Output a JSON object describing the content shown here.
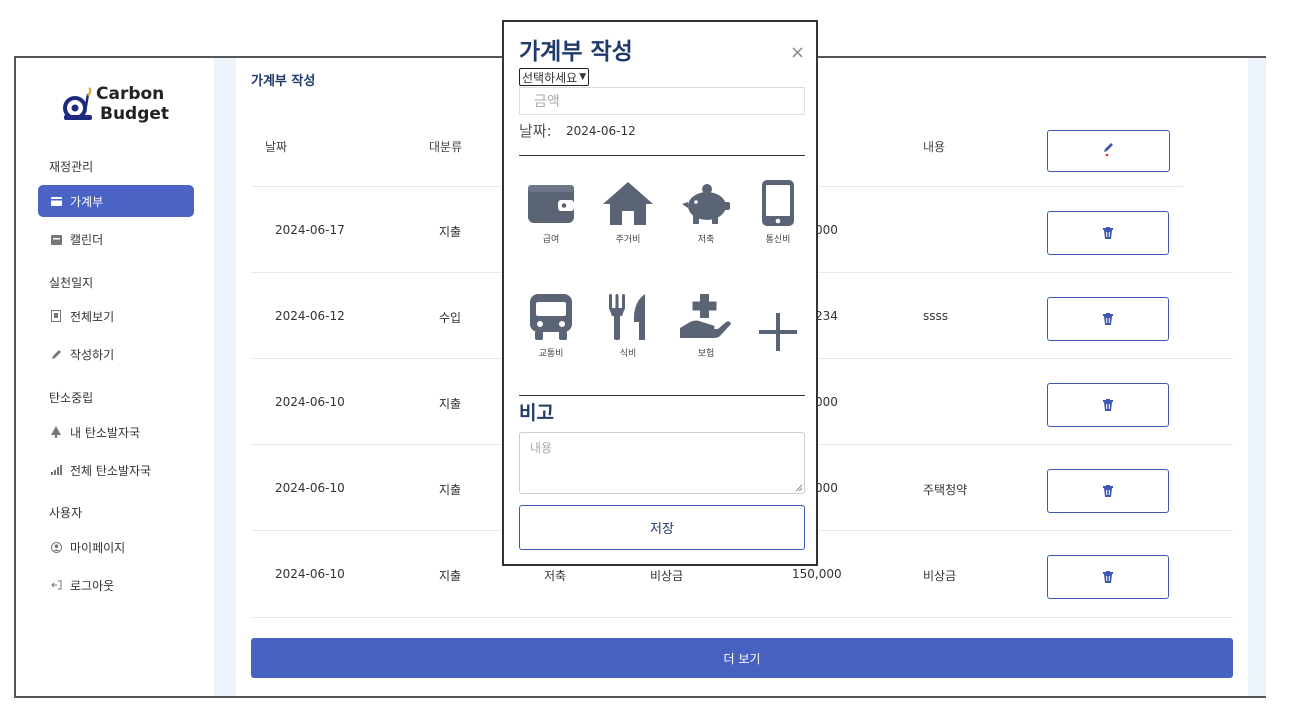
{
  "logo": {
    "line1": "Carbon",
    "line2": "Budget"
  },
  "sidebar": {
    "sections": [
      {
        "title": "재정관리",
        "items": [
          {
            "label": "가계부",
            "icon": "wallet-icon",
            "active": true
          },
          {
            "label": "캘린더",
            "icon": "calendar-icon",
            "active": false
          }
        ]
      },
      {
        "title": "실천일지",
        "items": [
          {
            "label": "전체보기",
            "icon": "list-icon",
            "active": false
          },
          {
            "label": "작성하기",
            "icon": "pencil-icon",
            "active": false
          }
        ]
      },
      {
        "title": "탄소중립",
        "items": [
          {
            "label": "내 탄소발자국",
            "icon": "tree-icon",
            "active": false
          },
          {
            "label": "전체 탄소발자국",
            "icon": "bar-chart-icon",
            "active": false
          }
        ]
      },
      {
        "title": "사용자",
        "items": [
          {
            "label": "마이페이지",
            "icon": "user-circle-icon",
            "active": false
          },
          {
            "label": "로그아웃",
            "icon": "logout-icon",
            "active": false
          }
        ]
      }
    ]
  },
  "main": {
    "title": "가계부 작성",
    "columns": [
      "날짜",
      "대분류",
      "내용"
    ],
    "rows": [
      {
        "date": "2024-06-17",
        "type": "지출",
        "sub": "",
        "detail": "",
        "amount": "000",
        "memo": ""
      },
      {
        "date": "2024-06-12",
        "type": "수입",
        "sub": "",
        "detail": "",
        "amount": "234",
        "memo": "ssss"
      },
      {
        "date": "2024-06-10",
        "type": "지출",
        "sub": "",
        "detail": "",
        "amount": "000",
        "memo": ""
      },
      {
        "date": "2024-06-10",
        "type": "지출",
        "sub": "",
        "detail": "",
        "amount": "000",
        "memo": "주택청약"
      },
      {
        "date": "2024-06-10",
        "type": "지출",
        "sub": "저축",
        "detail": "비상금",
        "amount": "150,000",
        "memo": "비상금"
      }
    ],
    "more_label": "더 보기"
  },
  "modal": {
    "title": "가계부 작성",
    "close": "×",
    "select_value": "선택하세요",
    "amount_placeholder": "금액",
    "date_label": "날짜:",
    "date_value": "2024-06-12",
    "categories": [
      {
        "label": "급여",
        "icon": "wallet-icon"
      },
      {
        "label": "주거비",
        "icon": "house-icon"
      },
      {
        "label": "저축",
        "icon": "piggy-bank-icon"
      },
      {
        "label": "통신비",
        "icon": "mobile-phone-icon"
      },
      {
        "label": "교통비",
        "icon": "bus-icon"
      },
      {
        "label": "식비",
        "icon": "utensils-icon"
      },
      {
        "label": "보험",
        "icon": "hand-medical-icon"
      },
      {
        "label": "",
        "icon": "plus-icon"
      }
    ],
    "note_title": "비고",
    "note_placeholder": "내용",
    "save_label": "저장"
  },
  "colors": {
    "accent": "#4b63c5",
    "title": "#1f3a6b",
    "icon": "#5b6475",
    "background": "#eef4fc"
  }
}
